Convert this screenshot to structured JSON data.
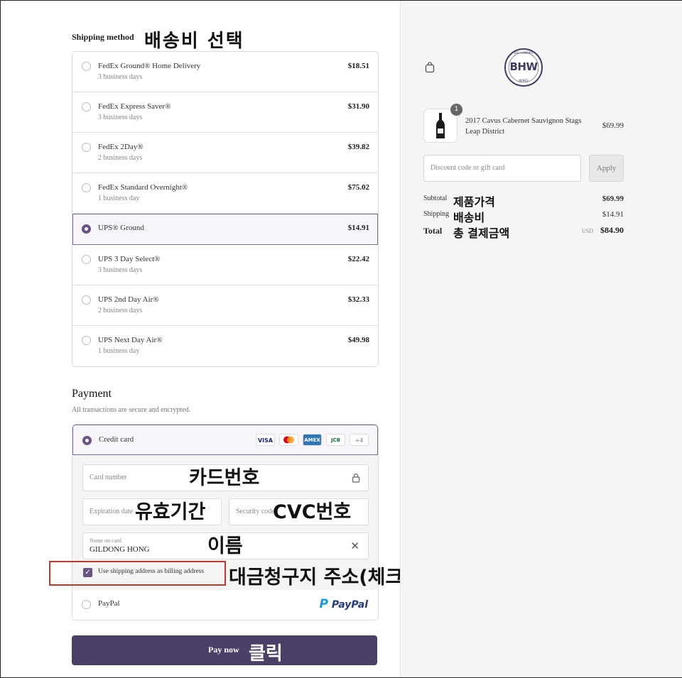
{
  "shipping": {
    "title": "Shipping method",
    "annotation": "배송비 선택",
    "options": [
      {
        "name": "FedEx Ground® Home Delivery",
        "days": "3 business days",
        "price": "$18.51",
        "selected": false
      },
      {
        "name": "FedEx Express Saver®",
        "days": "3 business days",
        "price": "$31.90",
        "selected": false
      },
      {
        "name": "FedEx 2Day®",
        "days": "2 business days",
        "price": "$39.82",
        "selected": false
      },
      {
        "name": "FedEx Standard Overnight®",
        "days": "1 business day",
        "price": "$75.02",
        "selected": false
      },
      {
        "name": "UPS® Ground",
        "days": "",
        "price": "$14.91",
        "selected": true
      },
      {
        "name": "UPS 3 Day Select®",
        "days": "3 business days",
        "price": "$22.42",
        "selected": false
      },
      {
        "name": "UPS 2nd Day Air®",
        "days": "2 business days",
        "price": "$32.33",
        "selected": false
      },
      {
        "name": "UPS Next Day Air®",
        "days": "1 business day",
        "price": "$49.98",
        "selected": false
      }
    ]
  },
  "payment": {
    "title": "Payment",
    "subtitle": "All transactions are secure and encrypted.",
    "credit_card_label": "Credit card",
    "card_brands": [
      "VISA",
      "",
      "AMEX",
      "JCB",
      "+4"
    ],
    "card_number_placeholder": "Card number",
    "card_number_annotation": "카드번호",
    "expiration_placeholder": "Expiration date",
    "expiration_annotation": "유효기간",
    "security_placeholder": "Security code",
    "security_annotation": "CVC번호",
    "name_label": "Name on card",
    "name_value": "GILDONG HONG",
    "name_annotation": "이름",
    "billing_checkbox_label": "Use shipping address as billing address",
    "billing_checked": true,
    "billing_annotation": "대금청구지 주소(체크o)",
    "paypal_label": "PayPal",
    "paypal_logo": "PayPal"
  },
  "pay_button": {
    "label": "Pay now",
    "annotation": "클릭",
    "color": "#4a3f66"
  },
  "summary": {
    "logo_text": "BHW",
    "logo_ring_top": "BIG HAMMER",
    "logo_ring_bottom": "WINES",
    "product_name": "2017 Cavus Cabernet Sauvignon Stags Leap District",
    "product_qty": "1",
    "product_price": "$69.99",
    "discount_placeholder": "Discount code or gift card",
    "apply_label": "Apply",
    "subtotal_label": "Subtotal",
    "subtotal_annotation": "제품가격",
    "subtotal_value": "$69.99",
    "shipping_label": "Shipping",
    "shipping_annotation": "배송비",
    "shipping_value": "$14.91",
    "total_label": "Total",
    "total_annotation": "총 결제금액",
    "currency": "USD",
    "total_value": "$84.90"
  },
  "colors": {
    "accent": "#6b5386",
    "annotation_box": "#c0392b"
  }
}
